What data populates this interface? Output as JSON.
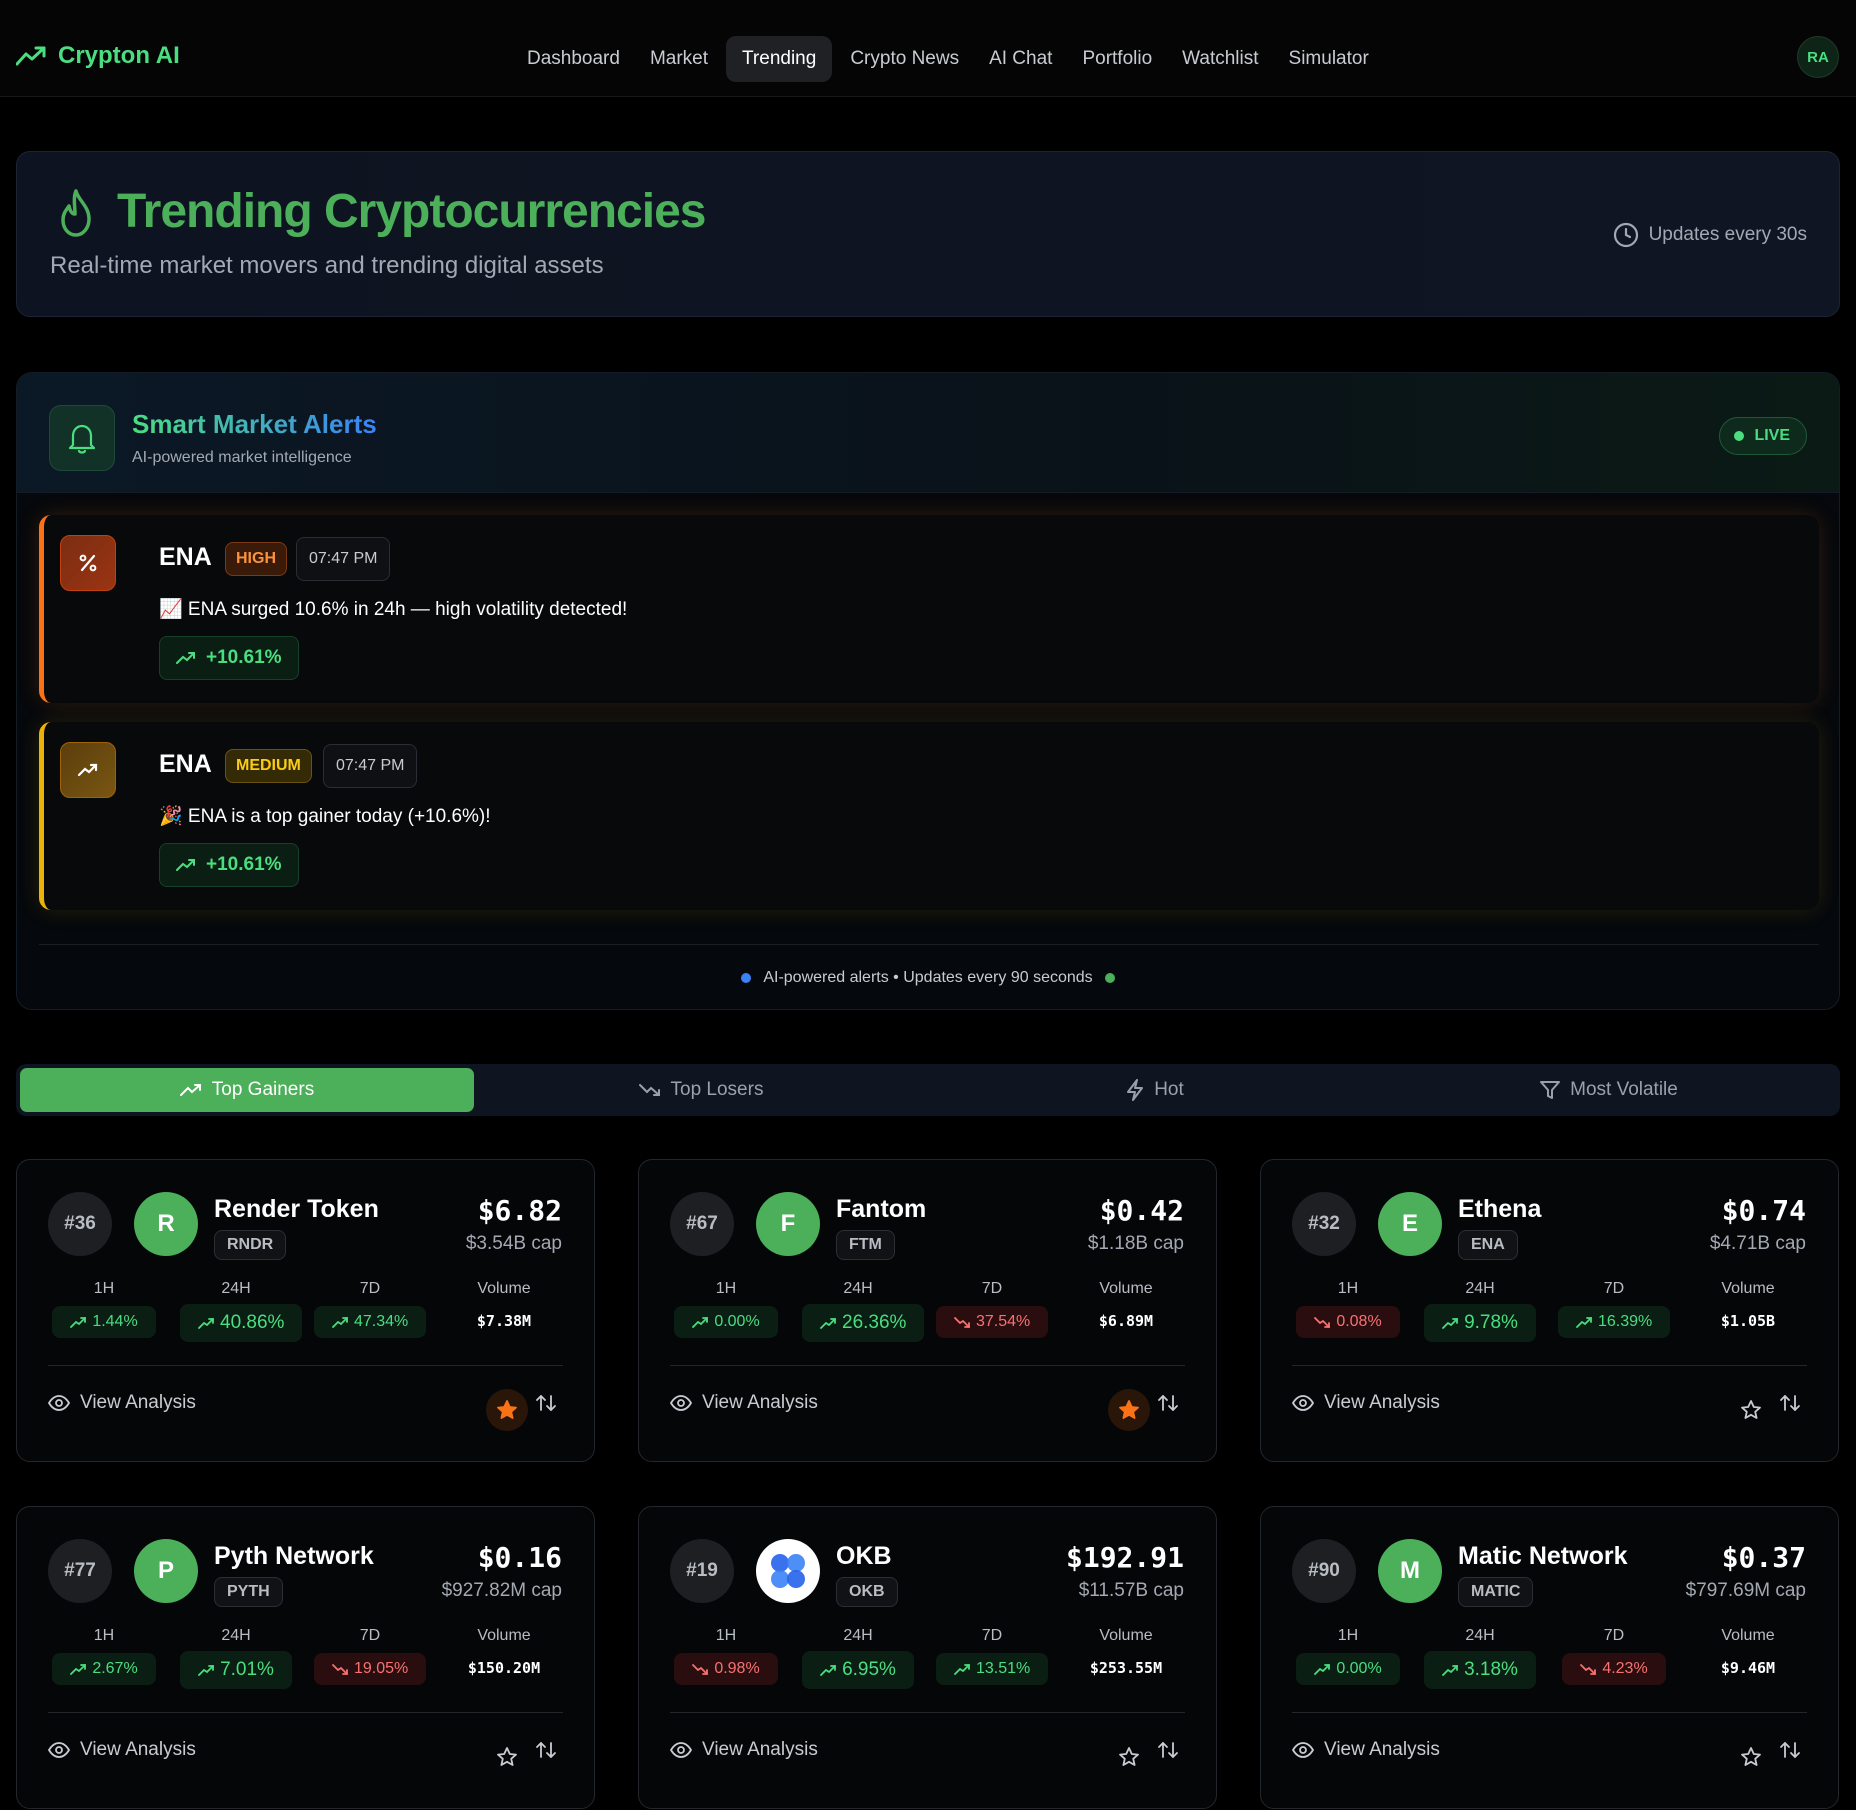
{
  "app": {
    "name": "Crypton AI",
    "avatar": "RA"
  },
  "nav": [
    {
      "label": "Dashboard",
      "active": false
    },
    {
      "label": "Market",
      "active": false
    },
    {
      "label": "Trending",
      "active": true
    },
    {
      "label": "Crypto News",
      "active": false
    },
    {
      "label": "AI Chat",
      "active": false
    },
    {
      "label": "Portfolio",
      "active": false
    },
    {
      "label": "Watchlist",
      "active": false
    },
    {
      "label": "Simulator",
      "active": false
    }
  ],
  "hero": {
    "title": "Trending Cryptocurrencies",
    "subtitle": "Real-time market movers and trending digital assets",
    "updates": "Updates every 30s"
  },
  "alerts": {
    "title": "Smart Market Alerts",
    "subtitle": "AI-powered market intelligence",
    "live": "LIVE",
    "items": [
      {
        "symbol": "ENA",
        "severity": "HIGH",
        "time": "07:47 PM",
        "message": "📈 ENA surged 10.6% in 24h — high volatility detected!",
        "change": "+10.61%",
        "icon": "percent-icon"
      },
      {
        "symbol": "ENA",
        "severity": "MEDIUM",
        "time": "07:47 PM",
        "message": "🎉 ENA is a top gainer today (+10.6%)!",
        "change": "+10.61%",
        "icon": "trending-up-icon"
      }
    ],
    "footer": "AI-powered alerts • Updates every 90 seconds"
  },
  "tabs": [
    {
      "label": "Top Gainers",
      "icon": "trending-up-icon",
      "active": true
    },
    {
      "label": "Top Losers",
      "icon": "trending-down-icon",
      "active": false
    },
    {
      "label": "Hot",
      "icon": "lightning-icon",
      "active": false
    },
    {
      "label": "Most Volatile",
      "icon": "filter-icon",
      "active": false
    }
  ],
  "labels": {
    "h1": "1H",
    "h24": "24H",
    "d7": "7D",
    "volume": "Volume",
    "view": "View Analysis"
  },
  "cards": [
    {
      "rank": "#36",
      "logo": "R",
      "name": "Render Token",
      "symbol": "RNDR",
      "price": "$6.82",
      "cap": "$3.54B cap",
      "h1": "1.44%",
      "h1_dir": "up",
      "h24": "40.86%",
      "h24_dir": "up",
      "d7": "47.34%",
      "d7_dir": "up",
      "volume": "$7.38M",
      "starred": true
    },
    {
      "rank": "#67",
      "logo": "F",
      "name": "Fantom",
      "symbol": "FTM",
      "price": "$0.42",
      "cap": "$1.18B cap",
      "h1": "0.00%",
      "h1_dir": "up",
      "h24": "26.36%",
      "h24_dir": "up",
      "d7": "37.54%",
      "d7_dir": "down",
      "volume": "$6.89M",
      "starred": true
    },
    {
      "rank": "#32",
      "logo": "E",
      "name": "Ethena",
      "symbol": "ENA",
      "price": "$0.74",
      "cap": "$4.71B cap",
      "h1": "0.08%",
      "h1_dir": "down",
      "h24": "9.78%",
      "h24_dir": "up",
      "d7": "16.39%",
      "d7_dir": "up",
      "volume": "$1.05B",
      "starred": false
    },
    {
      "rank": "#77",
      "logo": "P",
      "name": "Pyth Network",
      "symbol": "PYTH",
      "price": "$0.16",
      "cap": "$927.82M cap",
      "h1": "2.67%",
      "h1_dir": "up",
      "h24": "7.01%",
      "h24_dir": "up",
      "d7": "19.05%",
      "d7_dir": "down",
      "volume": "$150.20M",
      "starred": false
    },
    {
      "rank": "#19",
      "logo": "",
      "name": "OKB",
      "symbol": "OKB",
      "price": "$192.91",
      "cap": "$11.57B cap",
      "h1": "0.98%",
      "h1_dir": "down",
      "h24": "6.95%",
      "h24_dir": "up",
      "d7": "13.51%",
      "d7_dir": "up",
      "volume": "$253.55M",
      "starred": false
    },
    {
      "rank": "#90",
      "logo": "M",
      "name": "Matic Network",
      "symbol": "MATIC",
      "price": "$0.37",
      "cap": "$797.69M cap",
      "h1": "0.00%",
      "h1_dir": "up",
      "h24": "3.18%",
      "h24_dir": "up",
      "d7": "4.23%",
      "d7_dir": "down",
      "volume": "$9.46M",
      "starred": false
    }
  ],
  "colors": {
    "accent": "#4ade80",
    "brand_green": "#4caf5a",
    "down": "#f87171",
    "high": "#f97316",
    "medium": "#eab308"
  }
}
